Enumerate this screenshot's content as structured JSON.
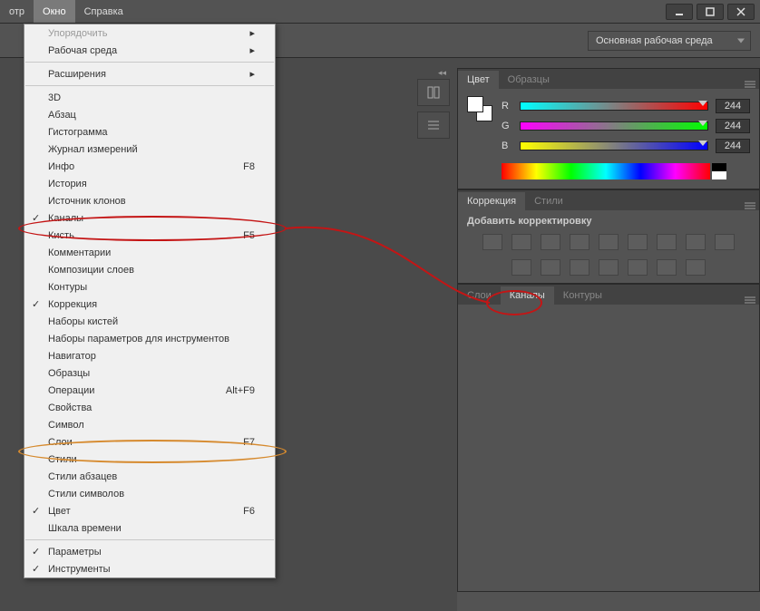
{
  "menubar": {
    "prev": "отр",
    "window": "Окно",
    "help": "Справка"
  },
  "workspace": {
    "label": "Основная рабочая среда"
  },
  "dropdown": {
    "arrange": "Упорядочить",
    "workspace": "Рабочая среда",
    "extensions": "Расширения",
    "threeD": "3D",
    "paragraph": "Абзац",
    "histogram": "Гистограмма",
    "measureLog": "Журнал измерений",
    "info": "Инфо",
    "infoKey": "F8",
    "history": "История",
    "clone": "Источник клонов",
    "channels": "Каналы",
    "brush": "Кисть",
    "brushKey": "F5",
    "comments": "Комментарии",
    "layerComps": "Композиции слоев",
    "paths": "Контуры",
    "adjustments": "Коррекция",
    "brushPresets": "Наборы кистей",
    "toolPresets": "Наборы параметров для инструментов",
    "navigator": "Навигатор",
    "swatches": "Образцы",
    "actions": "Операции",
    "actionsKey": "Alt+F9",
    "properties": "Свойства",
    "symbol": "Символ",
    "layers": "Слои",
    "layersKey": "F7",
    "styles": "Стили",
    "paraStyles": "Стили абзацев",
    "charStyles": "Стили символов",
    "color": "Цвет",
    "colorKey": "F6",
    "timeline": "Шкала времени",
    "options": "Параметры",
    "tools": "Инструменты"
  },
  "color_panel": {
    "tab_color": "Цвет",
    "tab_swatches": "Образцы",
    "r": "R",
    "g": "G",
    "b": "B",
    "rv": "244",
    "gv": "244",
    "bv": "244"
  },
  "adjust_panel": {
    "tab_adj": "Коррекция",
    "tab_styles": "Стили",
    "title": "Добавить корректировку"
  },
  "layers_panel": {
    "tab_layers": "Слои",
    "tab_channels": "Каналы",
    "tab_paths": "Контуры"
  }
}
